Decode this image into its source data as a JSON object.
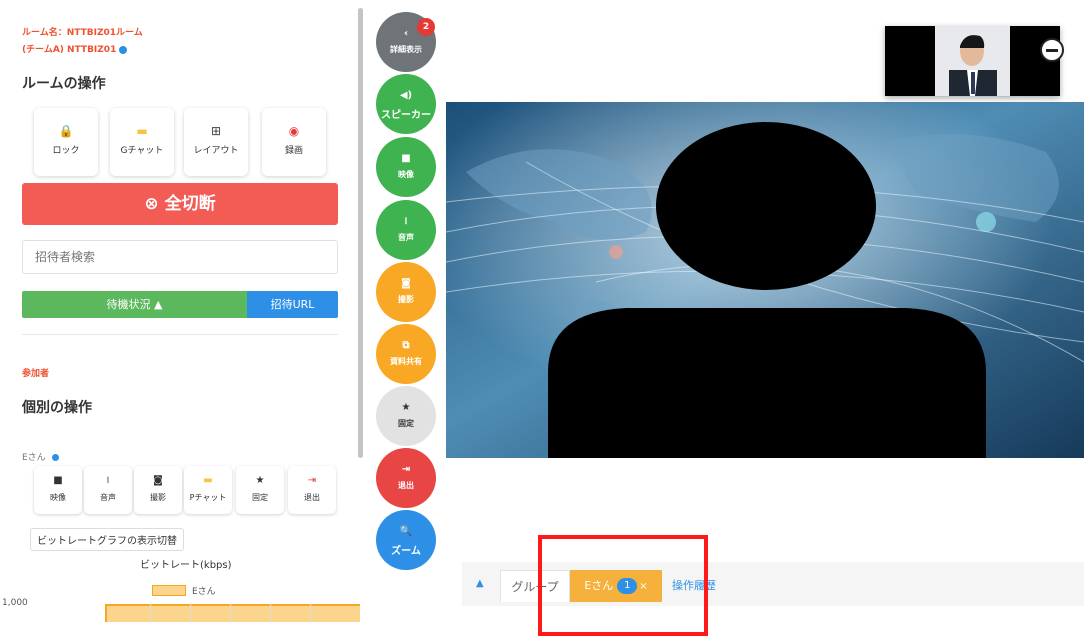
{
  "room": {
    "name_line": "ルーム名：NTTBIZ01ルーム",
    "team_line": "(チームA) NTTBIZ01"
  },
  "room_ops": {
    "title": "ルームの操作",
    "buttons": [
      {
        "label": "ロック",
        "icon": "lock-icon",
        "glyph": "🔒",
        "color": "#e53935"
      },
      {
        "label": "Gチャット",
        "icon": "group-chat-icon",
        "glyph": "▬",
        "color": "#f5c542"
      },
      {
        "label": "レイアウト",
        "icon": "layout-icon",
        "glyph": "⊞",
        "color": "#444444"
      },
      {
        "label": "録画",
        "icon": "record-icon",
        "glyph": "◉",
        "color": "#e53935"
      }
    ],
    "disconnect_all": "⊗  全切断",
    "search_placeholder": "招待者検索",
    "wait_status": "待機状況 ▲",
    "invite_url": "招待URL"
  },
  "participants": {
    "label": "参加者",
    "individual_title": "個別の操作",
    "name": "Eさん",
    "buttons": [
      {
        "label": "映像",
        "icon": "video-icon",
        "glyph": "■",
        "color": "#333333"
      },
      {
        "label": "音声",
        "icon": "mic-icon",
        "glyph": "⏽",
        "color": "#333333"
      },
      {
        "label": "撮影",
        "icon": "camera-icon",
        "glyph": "◙",
        "color": "#333333"
      },
      {
        "label": "Pチャット",
        "icon": "private-chat-icon",
        "glyph": "▬",
        "color": "#f5c542"
      },
      {
        "label": "固定",
        "icon": "pin-star-icon",
        "glyph": "★",
        "color": "#333333"
      },
      {
        "label": "退出",
        "icon": "exit-icon",
        "glyph": "⇥",
        "color": "#e53935"
      }
    ],
    "bitrate_toggle": "ビットレートグラフの表示切替",
    "bitrate_title": "ビットレート(kbps)",
    "legend": "Eさん",
    "y_tick": "1,000"
  },
  "controls": [
    {
      "label": "詳細表示",
      "icon": "chevron-left-icon",
      "glyph": "‹",
      "color": "#6f7479",
      "badge": "2"
    },
    {
      "label": "スピーカー",
      "icon": "speaker-icon",
      "glyph": "◀)",
      "color": "#3fb34f"
    },
    {
      "label": "映像",
      "icon": "video-icon",
      "glyph": "■",
      "color": "#3fb34f"
    },
    {
      "label": "音声",
      "icon": "mic-icon",
      "glyph": "⏽",
      "color": "#3fb34f"
    },
    {
      "label": "撮影",
      "icon": "camera-icon",
      "glyph": "◙",
      "color": "#f9a825"
    },
    {
      "label": "資料共有",
      "icon": "share-doc-icon",
      "glyph": "⧉",
      "color": "#f9a825"
    },
    {
      "label": "固定",
      "icon": "pin-star-icon",
      "glyph": "★",
      "color": "#e2e2e2"
    },
    {
      "label": "退出",
      "icon": "exit-icon",
      "glyph": "⇥",
      "color": "#e84545"
    },
    {
      "label": "ズーム",
      "icon": "zoom-icon",
      "glyph": "🔍",
      "color": "#2d8fe6"
    }
  ],
  "tabs": {
    "toggle": "▲",
    "group": "グループ",
    "participant": "Eさん",
    "participant_count": "1",
    "close": "×",
    "history": "操作履歴"
  },
  "colors": {
    "accent_red": "#f25c54",
    "accent_green": "#5cb85c",
    "accent_blue": "#2d8fe6",
    "accent_orange": "#f5b13b",
    "highlight": "#ff1a1a"
  }
}
